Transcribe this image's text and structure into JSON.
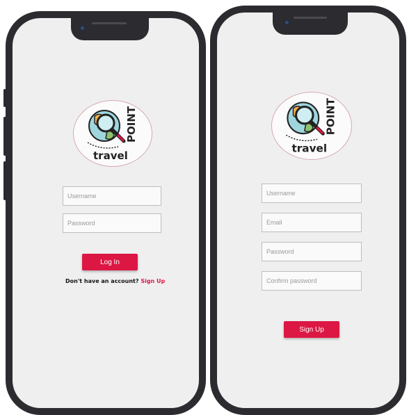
{
  "colors": {
    "accent": "#dd1744",
    "screen": "#efefef",
    "bezel": "#2c2c30"
  },
  "logo": {
    "brand_word": "POINT",
    "brand_sub": "travel"
  },
  "login": {
    "username_placeholder": "Username",
    "password_placeholder": "Password",
    "login_button": "Log In",
    "no_account_text": "Don't have an account?",
    "signup_link": "Sign Up"
  },
  "register": {
    "username_placeholder": "Username",
    "email_placeholder": "Email",
    "password_placeholder": "Password",
    "confirm_placeholder": "Confirm password",
    "signup_button": "Sign Up"
  }
}
